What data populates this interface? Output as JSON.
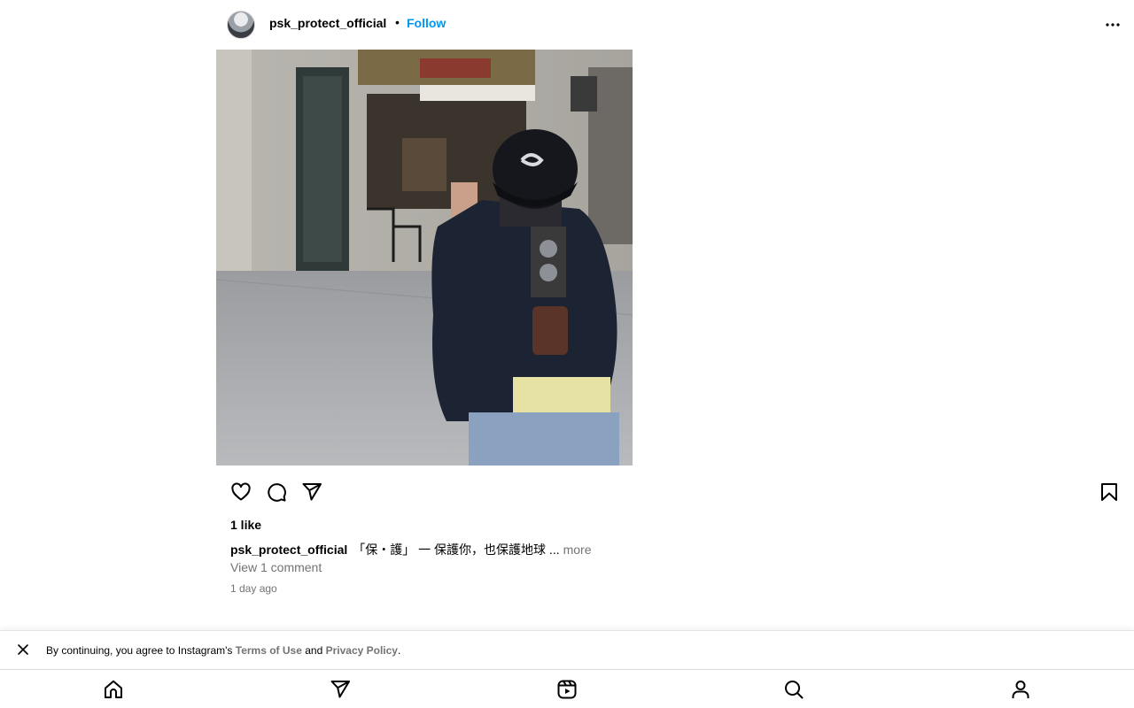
{
  "post": {
    "username": "psk_protect_official",
    "separator": "•",
    "follow_label": "Follow",
    "likes": "1 like",
    "caption_user": "psk_protect_official",
    "caption_text": "「保・護」 一 保護你，也保護地球 ...",
    "caption_more": "more",
    "view_comments": "View 1 comment",
    "timestamp": "1 day ago"
  },
  "consent": {
    "prefix": "By continuing, you agree to Instagram's ",
    "terms": "Terms of Use",
    "and": " and ",
    "privacy": "Privacy Policy",
    "suffix": "."
  },
  "icons": {
    "header": [
      "avatar",
      "more-options-icon"
    ],
    "actions": [
      "heart-icon",
      "comment-icon",
      "share-icon",
      "bookmark-icon"
    ],
    "nav": [
      "home-icon",
      "direct-icon",
      "reels-icon",
      "search-icon",
      "profile-icon"
    ]
  },
  "colors": {
    "link": "#0095f6",
    "muted": "#737373",
    "text": "#000000"
  }
}
